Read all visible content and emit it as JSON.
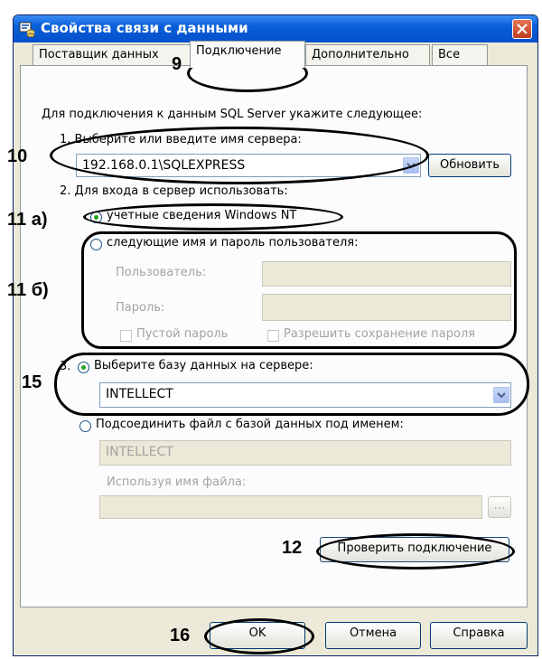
{
  "window": {
    "title": "Свойства связи с данными",
    "colors": {
      "titlebar": "#0a5fd8",
      "face": "#ece9d8",
      "annotation": "#000000"
    }
  },
  "tabs": [
    {
      "label": "Поставщик данных"
    },
    {
      "label": "Подключение"
    },
    {
      "label": "Дополнительно"
    },
    {
      "label": "Все"
    }
  ],
  "panel": {
    "intro": "Для подключения к данным SQL Server укажите следующее:",
    "step1_label": "1. Выберите или введите имя сервера:",
    "server_value": "192.168.0.1\\SQLEXPRESS",
    "refresh_label": "Обновить",
    "step2_label": "2. Для входа в сервер использовать:",
    "radio_windows_nt": "учетные сведения Windows NT",
    "radio_user_pass": "следующие имя и пароль пользователя:",
    "user_label": "Пользователь:",
    "password_label": "Пароль:",
    "blank_password_label": "Пустой пароль",
    "allow_save_label": "Разрешить сохранение пароля",
    "step3_prefix": "3.",
    "radio_select_db": "Выберите базу данных на сервере:",
    "db_value": "INTELLECT",
    "radio_attach_file": "Подсоединить файл с базой данных под именем:",
    "attach_value": "INTELLECT",
    "file_name_label": "Используя имя файла:",
    "browse_label": "...",
    "test_connection_label": "Проверить подключение"
  },
  "footer": {
    "ok_label": "OK",
    "cancel_label": "Отмена",
    "help_label": "Справка"
  },
  "annotations": {
    "n9": "9",
    "n10": "10",
    "n11a": "11 а)",
    "n11b": "11 б)",
    "n15": "15",
    "n12": "12",
    "n16": "16"
  }
}
